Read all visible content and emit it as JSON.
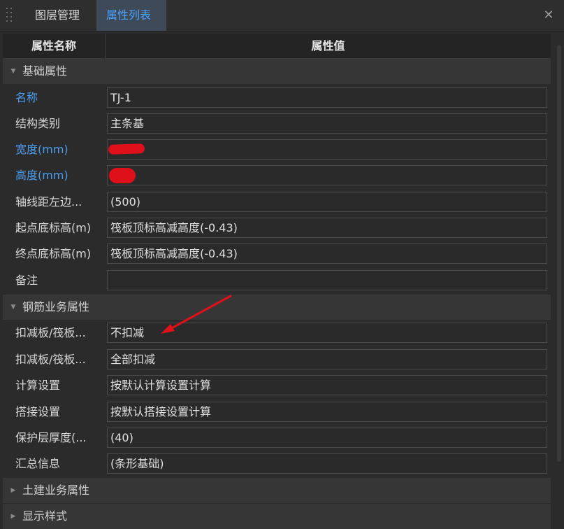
{
  "tabs": [
    {
      "label": "图层管理",
      "active": false
    },
    {
      "label": "属性列表",
      "active": true
    }
  ],
  "header": {
    "col_name": "属性名称",
    "col_value": "属性值"
  },
  "groups": {
    "basic": {
      "label": "基础属性",
      "expanded": true,
      "rows": [
        {
          "label": "名称",
          "value": "TJ-1",
          "highlight": true
        },
        {
          "label": "结构类别",
          "value": "主条基",
          "highlight": false
        },
        {
          "label": "宽度(mm)",
          "value": "",
          "highlight": true,
          "redacted": true
        },
        {
          "label": "高度(mm)",
          "value": "",
          "highlight": true,
          "redacted": true
        },
        {
          "label": "轴线距左边...",
          "value": "(500)",
          "highlight": false
        },
        {
          "label": "起点底标高(m)",
          "value": "筏板顶标高减高度(-0.43)",
          "highlight": false
        },
        {
          "label": "终点底标高(m)",
          "value": "筏板顶标高减高度(-0.43)",
          "highlight": false
        },
        {
          "label": "备注",
          "value": "",
          "highlight": false
        }
      ]
    },
    "rebar": {
      "label": "钢筋业务属性",
      "expanded": true,
      "rows": [
        {
          "label": "扣减板/筏板...",
          "value": "不扣减"
        },
        {
          "label": "扣减板/筏板...",
          "value": "全部扣减"
        },
        {
          "label": "计算设置",
          "value": "按默认计算设置计算"
        },
        {
          "label": "搭接设置",
          "value": "按默认搭接设置计算"
        },
        {
          "label": "保护层厚度(...",
          "value": "(40)"
        },
        {
          "label": "汇总信息",
          "value": "(条形基础)"
        }
      ]
    },
    "civil": {
      "label": "土建业务属性",
      "expanded": false
    },
    "display": {
      "label": "显示样式",
      "expanded": false
    }
  },
  "colors": {
    "accent": "#4aa3ff",
    "label_blue": "#4c9cf0",
    "annotation_red": "#e0101a"
  },
  "icons": {
    "grip": "grip-dots-icon",
    "close": "close-icon",
    "expanded": "triangle-down-icon",
    "collapsed": "triangle-right-icon"
  }
}
